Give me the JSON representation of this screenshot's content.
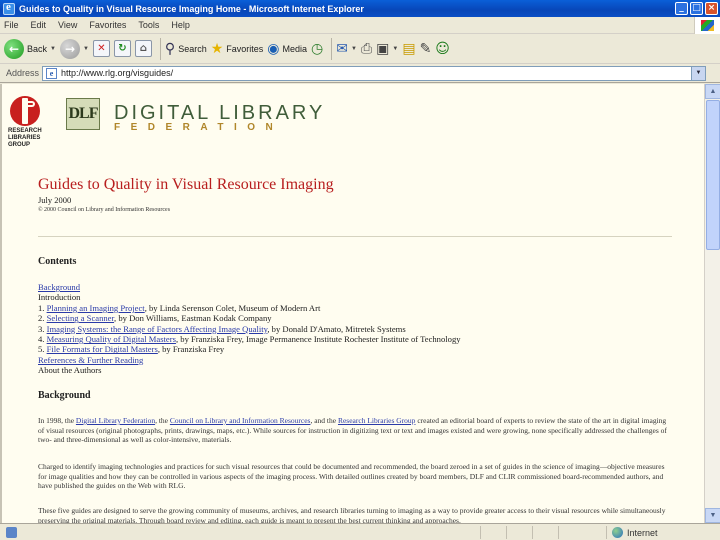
{
  "window": {
    "title": "Guides to Quality in Visual Resource Imaging Home - Microsoft Internet Explorer",
    "minimize": "_",
    "maximize": "□",
    "close": "×"
  },
  "menu": [
    "File",
    "Edit",
    "View",
    "Favorites",
    "Tools",
    "Help"
  ],
  "toolbar": {
    "back": "Back",
    "search": "Search",
    "favorites": "Favorites",
    "media": "Media"
  },
  "address": {
    "label": "Address",
    "url": "http://www.rlg.org/visguides/"
  },
  "logos": {
    "rlg_lines": [
      "RESEARCH",
      "LIBRARIES",
      "GROUP"
    ],
    "dlf_mark": "DLF",
    "dlf_title": "DIGITAL LIBRARY",
    "dlf_subtitle": "FEDERATION"
  },
  "doc": {
    "title": "Guides to Quality in Visual Resource Imaging",
    "date": "July 2000",
    "copyright": "© 2000 Council on Library and Information Resources",
    "contents_heading": "Contents",
    "toc": [
      {
        "prefix": "",
        "link": "Background",
        "suffix": ""
      },
      {
        "prefix": "Introduction",
        "link": "",
        "suffix": ""
      },
      {
        "prefix": "1. ",
        "link": "Planning an Imaging Project",
        "suffix": ", by Linda Serenson Colet, Museum of Modern Art"
      },
      {
        "prefix": "2. ",
        "link": "Selecting a Scanner",
        "suffix": ", by Don Williams, Eastman Kodak Company"
      },
      {
        "prefix": "3. ",
        "link": "Imaging Systems: the Range of Factors Affecting Image Quality",
        "suffix": ", by Donald D'Amato, Mitretek Systems"
      },
      {
        "prefix": "4. ",
        "link": "Measuring Quality of Digital Masters",
        "suffix": ", by Franziska Frey, Image Permanence Institute Rochester Institute of Technology"
      },
      {
        "prefix": "5. ",
        "link": "File Formats for Digital Masters",
        "suffix": ", by Franziska Frey"
      },
      {
        "prefix": "",
        "link": "References & Further Reading",
        "suffix": ""
      },
      {
        "prefix": "About the Authors",
        "link": "",
        "suffix": ""
      }
    ],
    "background_heading": "Background",
    "p1": {
      "t1": "In 1998, the ",
      "l1": "Digital Library Federation",
      "t2": ", the ",
      "l2": "Council on Library and Information Resources",
      "t3": ", and the ",
      "l3": "Research Libraries Group",
      "t4": " created an editorial board of experts to review the state of the art in digital imaging of visual resources (original photographs, prints, drawings, maps, etc.). While sources for instruction in digitizing text or text and images existed and were growing, none specifically addressed the challenges of two- and three-dimensional as well as color-intensive, materials."
    },
    "p2": "Charged to identify imaging technologies and practices for such visual resources that could be documented and recommended, the board zeroed in a set of guides in the science of imaging—objective measures for image qualities and how they can be controlled in various aspects of the imaging process. With detailed outlines created by board members, DLF and CLIR commissioned board-recommended authors, and have published the guides on the Web with RLG.",
    "p3": "These five guides are designed to serve the growing community of museums, archives, and research libraries turning to imaging as a way to provide greater access to their visual resources while simultaneously preserving the original materials. Through board review and editing, each guide is meant to present the best current thinking and approaches."
  },
  "status": {
    "zone": "Internet"
  }
}
